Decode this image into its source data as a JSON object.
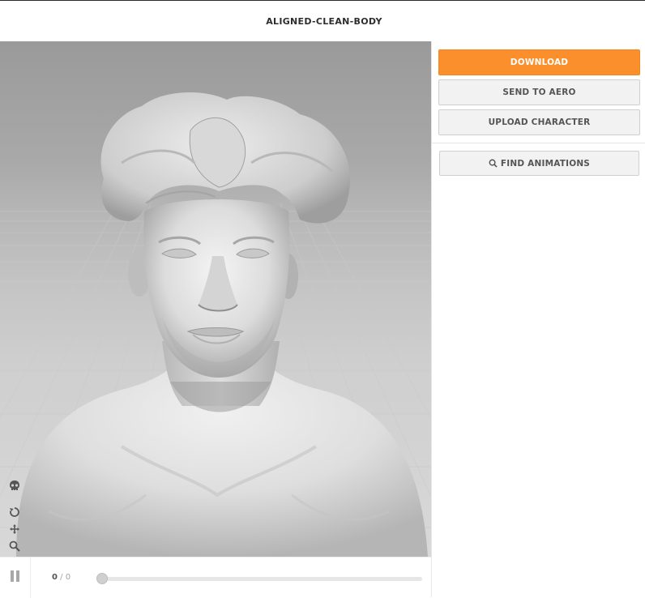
{
  "header": {
    "title": "ALIGNED-CLEAN-BODY"
  },
  "panel": {
    "download_label": "DOWNLOAD",
    "send_to_aero_label": "SEND TO AERO",
    "upload_character_label": "UPLOAD CHARACTER",
    "find_animations_label": "FIND ANIMATIONS",
    "find_animations_icon": "search-icon"
  },
  "viewport": {
    "tools": [
      "skull-icon",
      "rotate-icon",
      "move-icon",
      "zoom-icon",
      "power-icon",
      "square-icon"
    ]
  },
  "playback": {
    "play_icon": "pause-icon",
    "current_frame": "0",
    "separator": " / ",
    "total_frames": "0",
    "progress": 0
  },
  "colors": {
    "accent": "#fb8f2b",
    "button_bg": "#f2f2f2",
    "title_text": "#2e2e2e"
  }
}
